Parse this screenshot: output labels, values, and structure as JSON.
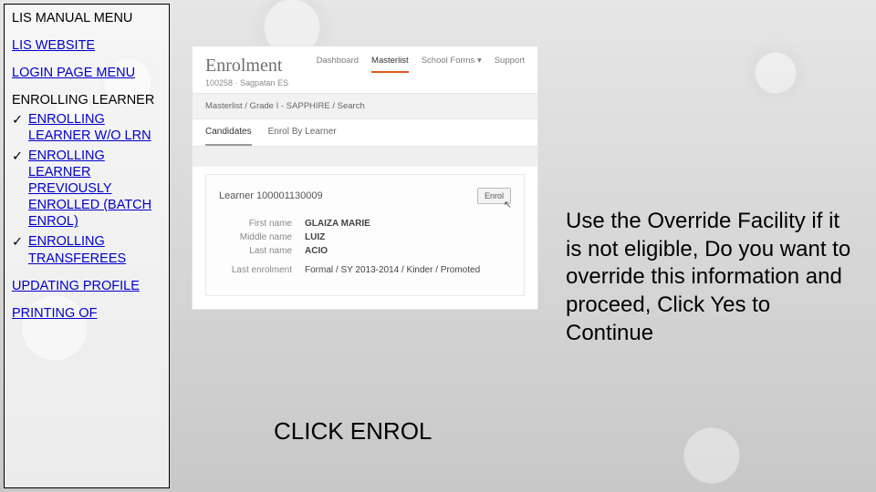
{
  "sidebar": {
    "title": "LIS MANUAL MENU",
    "items": [
      {
        "label": "LIS WEBSITE",
        "link": true
      },
      {
        "label": "LOGIN PAGE MENU",
        "link": true
      },
      {
        "label": "ENROLLING LEARNER",
        "link": false,
        "children": [
          "ENROLLING LEARNER W/O LRN",
          "ENROLLING LEARNER PREVIOUSLY ENROLLED (BATCH ENROL)",
          "ENROLLING TRANSFEREES"
        ]
      },
      {
        "label": "UPDATING PROFILE",
        "link": true
      },
      {
        "label": "PRINTING OF",
        "link": true,
        "cutoff": true
      }
    ]
  },
  "app": {
    "title": "Enrolment",
    "subtitle": "100258 · Sagpatan ES",
    "nav": [
      "Dashboard",
      "Masterlist",
      "School Forms ▾",
      "Support"
    ],
    "nav_active": "Masterlist",
    "breadcrumbs": "Masterlist  /  Grade I - SAPPHIRE  /  Search",
    "tabs": [
      "Candidates",
      "Enrol By Learner"
    ],
    "active_tab": "Candidates",
    "learner": {
      "label": "Learner",
      "lrn": "100001130009",
      "button": "Enrol",
      "fields": {
        "first_label": "First name",
        "first": "GLAIZA MARIE",
        "middle_label": "Middle name",
        "middle": "LUIZ",
        "last_label": "Last name",
        "last": "ACIO",
        "lastenrol_label": "Last enrolment",
        "lastenrol": "Formal / SY 2013-2014 / Kinder / Promoted"
      }
    }
  },
  "caption": "CLICK ENROL",
  "instruction": "Use the Override Facility if it is not eligible, Do you want to override this information and proceed, Click Yes to Continue"
}
